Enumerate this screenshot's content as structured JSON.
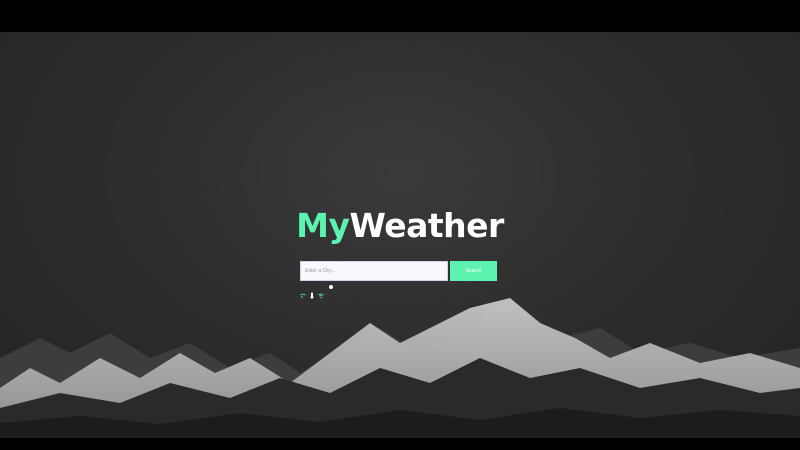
{
  "app": {
    "logo_part1": "My",
    "logo_part2": "Weather"
  },
  "search": {
    "placeholder": "Enter a City...",
    "button_label": "Search"
  },
  "icons": [
    "map-pin-icon",
    "thermometer-icon",
    "wifi-icon",
    "dot-icon"
  ],
  "colors": {
    "accent": "#5cf3b0",
    "logo_text": "#ffffff",
    "background": "#2e2e2f"
  }
}
